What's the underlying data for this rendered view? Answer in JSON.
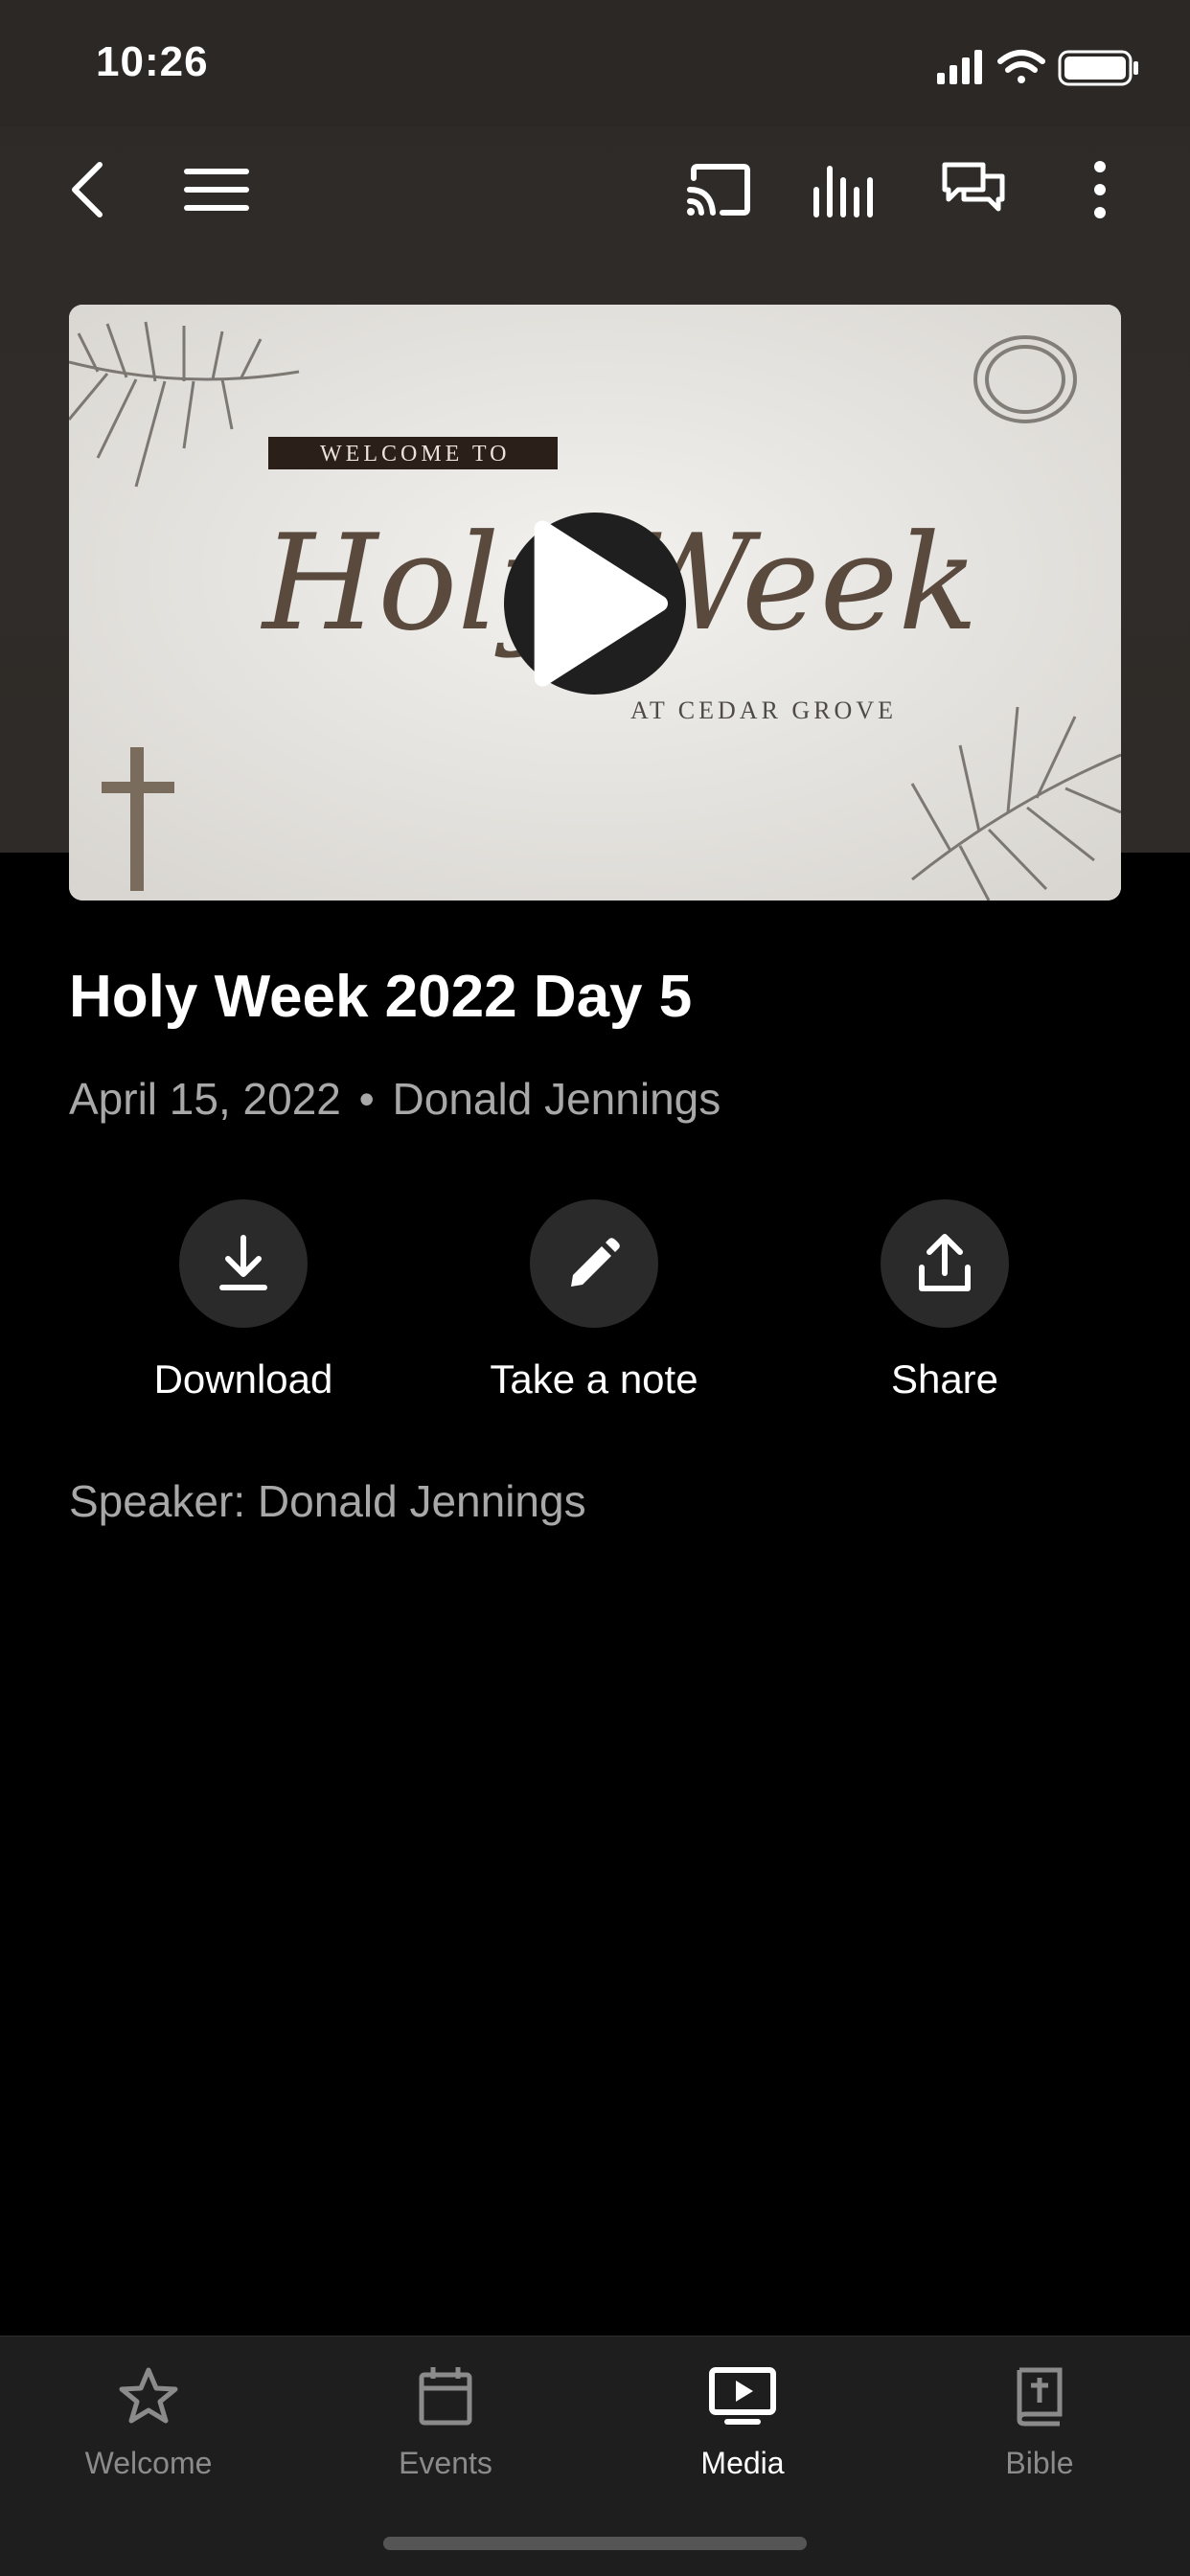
{
  "status": {
    "time": "10:26",
    "icons": [
      "signal-icon",
      "wifi-icon",
      "battery-icon"
    ]
  },
  "nav": {
    "icons": [
      "back-icon",
      "menu-icon",
      "cast-icon",
      "equalizer-icon",
      "chat-icon",
      "more-icon"
    ]
  },
  "video": {
    "thumbnail_text": {
      "welcome": "WELCOME TO",
      "title": "Holy Week",
      "subtitle": "AT CEDAR GROVE"
    },
    "play_icon": "play-icon"
  },
  "media": {
    "title": "Holy Week 2022 Day 5",
    "date": "April 15, 2022",
    "separator": "•",
    "author": "Donald Jennings",
    "speaker_line": "Speaker: Donald Jennings"
  },
  "actions": [
    {
      "label": "Download",
      "icon": "download-icon"
    },
    {
      "label": "Take a note",
      "icon": "pencil-icon"
    },
    {
      "label": "Share",
      "icon": "share-icon"
    }
  ],
  "tabs": [
    {
      "label": "Welcome",
      "icon": "star-icon",
      "active": false
    },
    {
      "label": "Events",
      "icon": "calendar-icon",
      "active": false
    },
    {
      "label": "Media",
      "icon": "media-icon",
      "active": true
    },
    {
      "label": "Bible",
      "icon": "bible-icon",
      "active": false
    }
  ],
  "colors": {
    "background": "#000000",
    "header": "#2d2a28",
    "muted_text": "#a8a8a8",
    "tabbar": "#1e1e1e"
  }
}
